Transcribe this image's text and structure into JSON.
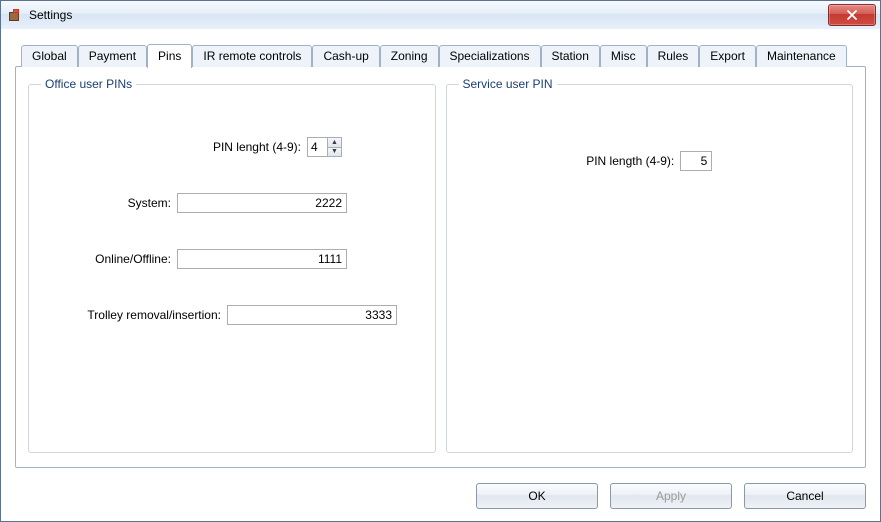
{
  "window": {
    "title": "Settings"
  },
  "tabs": [
    {
      "label": "Global"
    },
    {
      "label": "Payment"
    },
    {
      "label": "Pins"
    },
    {
      "label": "IR remote controls"
    },
    {
      "label": "Cash-up"
    },
    {
      "label": "Zoning"
    },
    {
      "label": "Specializations"
    },
    {
      "label": "Station"
    },
    {
      "label": "Misc"
    },
    {
      "label": "Rules"
    },
    {
      "label": "Export"
    },
    {
      "label": "Maintenance"
    }
  ],
  "active_tab_index": 2,
  "office_group": {
    "legend": "Office user PINs",
    "pin_length_label": "PIN lenght (4-9):",
    "pin_length_value": "4",
    "system_label": "System:",
    "system_value": "2222",
    "online_offline_label": "Online/Offline:",
    "online_offline_value": "1111",
    "trolley_label": "Trolley removal/insertion:",
    "trolley_value": "3333"
  },
  "service_group": {
    "legend": "Service user PIN",
    "pin_length_label": "PIN length (4-9):",
    "pin_length_value": "5"
  },
  "buttons": {
    "ok": "OK",
    "apply": "Apply",
    "cancel": "Cancel"
  }
}
